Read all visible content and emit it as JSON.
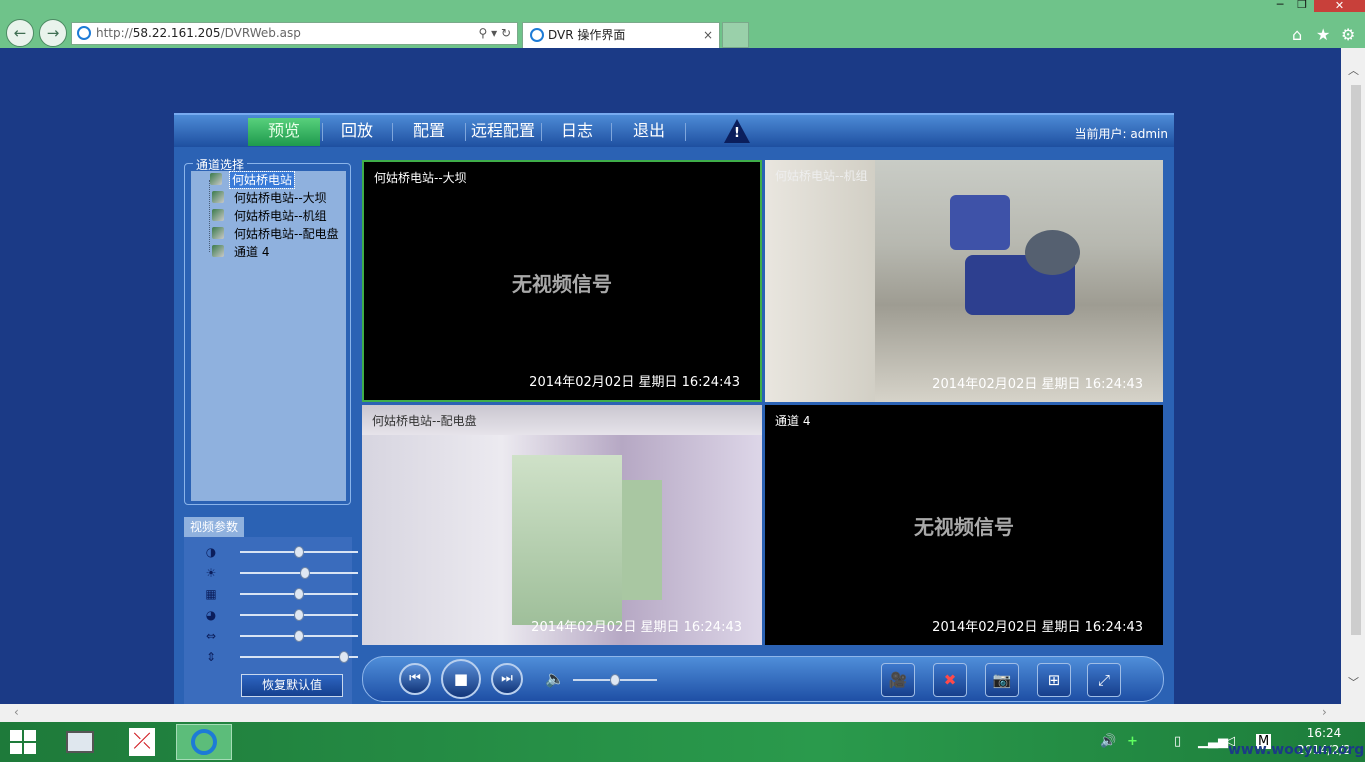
{
  "browser": {
    "url_base": "http://",
    "url_host": "58.22.161.205",
    "url_path": "/DVRWeb.asp",
    "address_controls": "⚲ ▾ ↻",
    "tab_title": "DVR 操作界面",
    "tab_close": "×",
    "window_controls": {
      "minimize": "─",
      "maximize": "❐",
      "close": "✕"
    },
    "toolbar_icons": {
      "home": "⌂",
      "favorites": "★",
      "settings": "⚙"
    }
  },
  "menu": {
    "items": [
      {
        "label": "预览",
        "active": true
      },
      {
        "label": "回放"
      },
      {
        "label": "配置"
      },
      {
        "label": "远程配置"
      },
      {
        "label": "日志"
      },
      {
        "label": "退出"
      }
    ],
    "alarm_glyph": "!",
    "current_user": "当前用户: admin"
  },
  "channel_panel": {
    "title": "通道选择",
    "items": [
      {
        "label": "何姑桥电站",
        "selected": true
      },
      {
        "label": "何姑桥电站--大坝"
      },
      {
        "label": "何姑桥电站--机组"
      },
      {
        "label": "何姑桥电站--配电盘"
      },
      {
        "label": "通道 4"
      }
    ]
  },
  "video_params": {
    "title": "视频参数",
    "sliders": [
      {
        "name": "contrast",
        "glyph": "◑",
        "level": 0.5
      },
      {
        "name": "brightness",
        "glyph": "☀",
        "level": 0.56
      },
      {
        "name": "saturation",
        "glyph": "▦",
        "level": 0.5
      },
      {
        "name": "hue",
        "glyph": "◕",
        "level": 0.5
      },
      {
        "name": "sharpness-h",
        "glyph": "⇔",
        "level": 0.5
      },
      {
        "name": "sharpness-v",
        "glyph": "⇕",
        "level": 0.92
      }
    ],
    "restore_label": "恢复默认值"
  },
  "videos": [
    {
      "name": "何姑桥电站--大坝",
      "timestamp": "2014年02月02日 星期日 16:24:43",
      "no_signal": "无视频信号"
    },
    {
      "name": "何姑桥电站--机组",
      "timestamp": "2014年02月02日 星期日 16:24:43",
      "no_signal": ""
    },
    {
      "name": "何姑桥电站--配电盘",
      "timestamp": "2014年02月02日 星期日 16:24:43",
      "no_signal": ""
    },
    {
      "name": "通道 4",
      "timestamp": "2014年02月02日 星期日 16:24:43",
      "no_signal": "无视频信号"
    }
  ],
  "controls": {
    "prev": "⏮",
    "play_stop": "■",
    "next": "⏭",
    "volume_glyph": "🔈",
    "volume_level": 0.5,
    "record": "🎥",
    "stop_record": "✖",
    "snapshot": "📷",
    "layout": "⊞",
    "fullscreen": "⤢"
  },
  "taskbar": {
    "clock_time": "16:24",
    "clock_date": "2014/2/2",
    "ime": "M",
    "watermark": "www.wooyun.org"
  },
  "colors": {
    "page_bg": "#1b3a86",
    "active_tab": "#1e9a4d",
    "selected_video_border": "#3fae4a"
  }
}
